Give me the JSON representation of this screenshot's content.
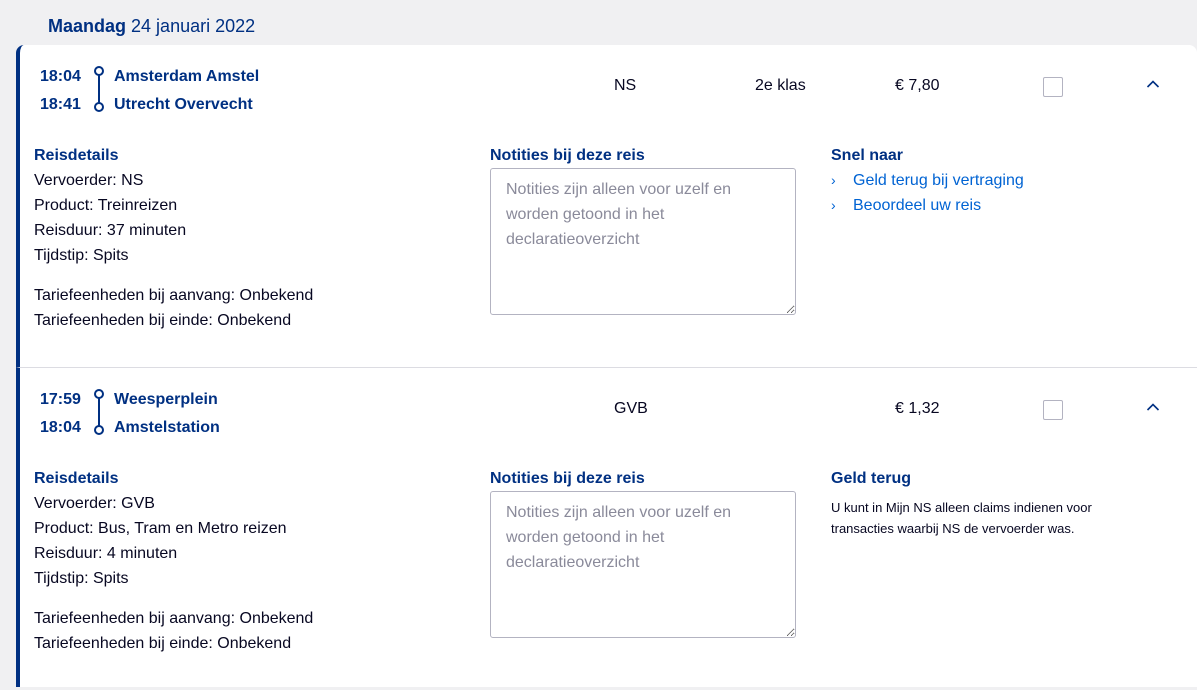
{
  "date": {
    "day": "Maandag",
    "rest": "24 januari 2022"
  },
  "labels": {
    "details_title": "Reisdetails",
    "notes_title": "Notities bij deze reis",
    "notes_placeholder": "Notities zijn alleen voor uzelf en worden getoond in het declaratieoverzicht"
  },
  "trips": [
    {
      "departure_time": "18:04",
      "arrival_time": "18:41",
      "from": "Amsterdam Amstel",
      "to": "Utrecht Overvecht",
      "carrier": "NS",
      "class": "2e klas",
      "price": "€ 7,80",
      "details": {
        "carrier": "Vervoerder: NS",
        "product": "Product: Treinreizen",
        "duration": "Reisduur: 37 minuten",
        "time_of_day": "Tijdstip: Spits",
        "tariff_start": "Tariefeenheden bij aanvang: Onbekend",
        "tariff_end": "Tariefeenheden bij einde: Onbekend"
      },
      "side": {
        "title": "Snel naar",
        "links": [
          "Geld terug bij vertraging",
          "Beoordeel uw reis"
        ]
      }
    },
    {
      "departure_time": "17:59",
      "arrival_time": "18:04",
      "from": "Weesperplein",
      "to": "Amstelstation",
      "carrier": "GVB",
      "price": "€ 1,32",
      "details": {
        "carrier": "Vervoerder: GVB",
        "product": "Product: Bus, Tram en Metro reizen",
        "duration": "Reisduur: 4 minuten",
        "time_of_day": "Tijdstip: Spits",
        "tariff_start": "Tariefeenheden bij aanvang: Onbekend",
        "tariff_end": "Tariefeenheden bij einde: Onbekend"
      },
      "side": {
        "title": "Geld terug",
        "text": "U kunt in Mijn NS alleen claims indienen voor transacties waarbij NS de vervoerder was."
      }
    }
  ],
  "colors": {
    "brand_blue": "#003082",
    "link_blue": "#0063d3",
    "background": "#f0f0f2"
  }
}
